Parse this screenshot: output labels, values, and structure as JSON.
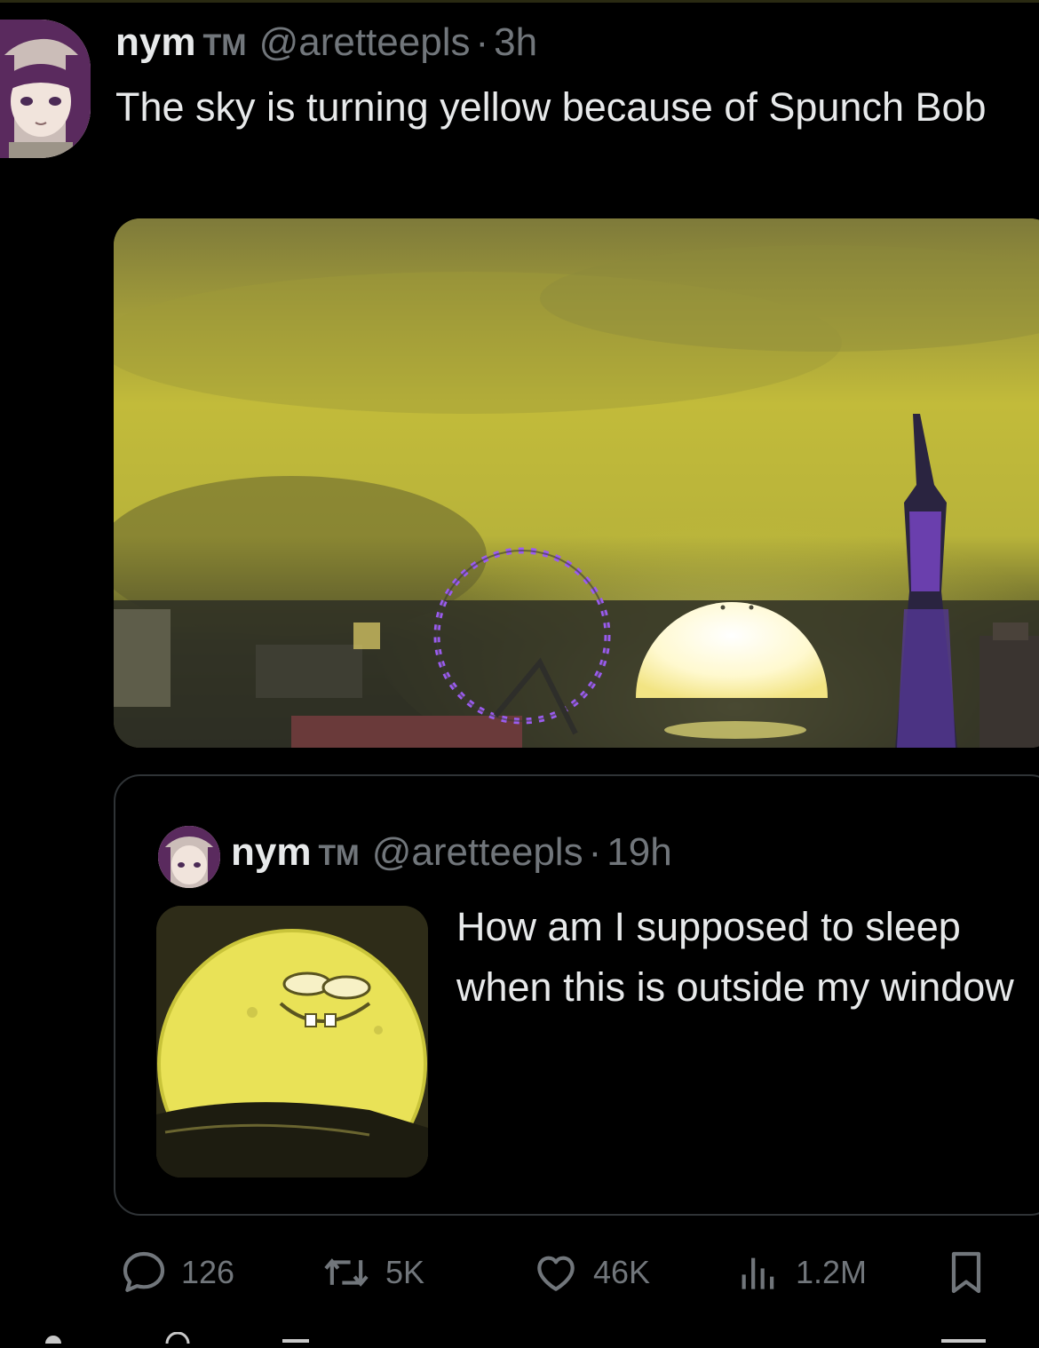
{
  "post": {
    "display_name": "nym",
    "tm": "TM",
    "handle": "@aretteepls",
    "separator": "·",
    "time": "3h",
    "text": "The sky is turning yellow because of Spunch Bob"
  },
  "quoted_post": {
    "display_name": "nym",
    "tm": "TM",
    "handle": "@aretteepls",
    "separator": "·",
    "time": "19h",
    "text": "How am I supposed to sleep when this is outside my window"
  },
  "actions": {
    "replies": "126",
    "reposts": "5K",
    "likes": "46K",
    "views": "1.2M"
  },
  "icons": {
    "reply": "reply-icon",
    "repost": "repost-icon",
    "like": "heart-icon",
    "views": "views-icon",
    "bookmark": "bookmark-icon"
  },
  "colors": {
    "background": "#000000",
    "text": "#e7e9ea",
    "muted": "#71767b",
    "border": "#2f3336",
    "sky_yellow": "#c9c23a",
    "wheel_purple": "#9b5cf0"
  }
}
